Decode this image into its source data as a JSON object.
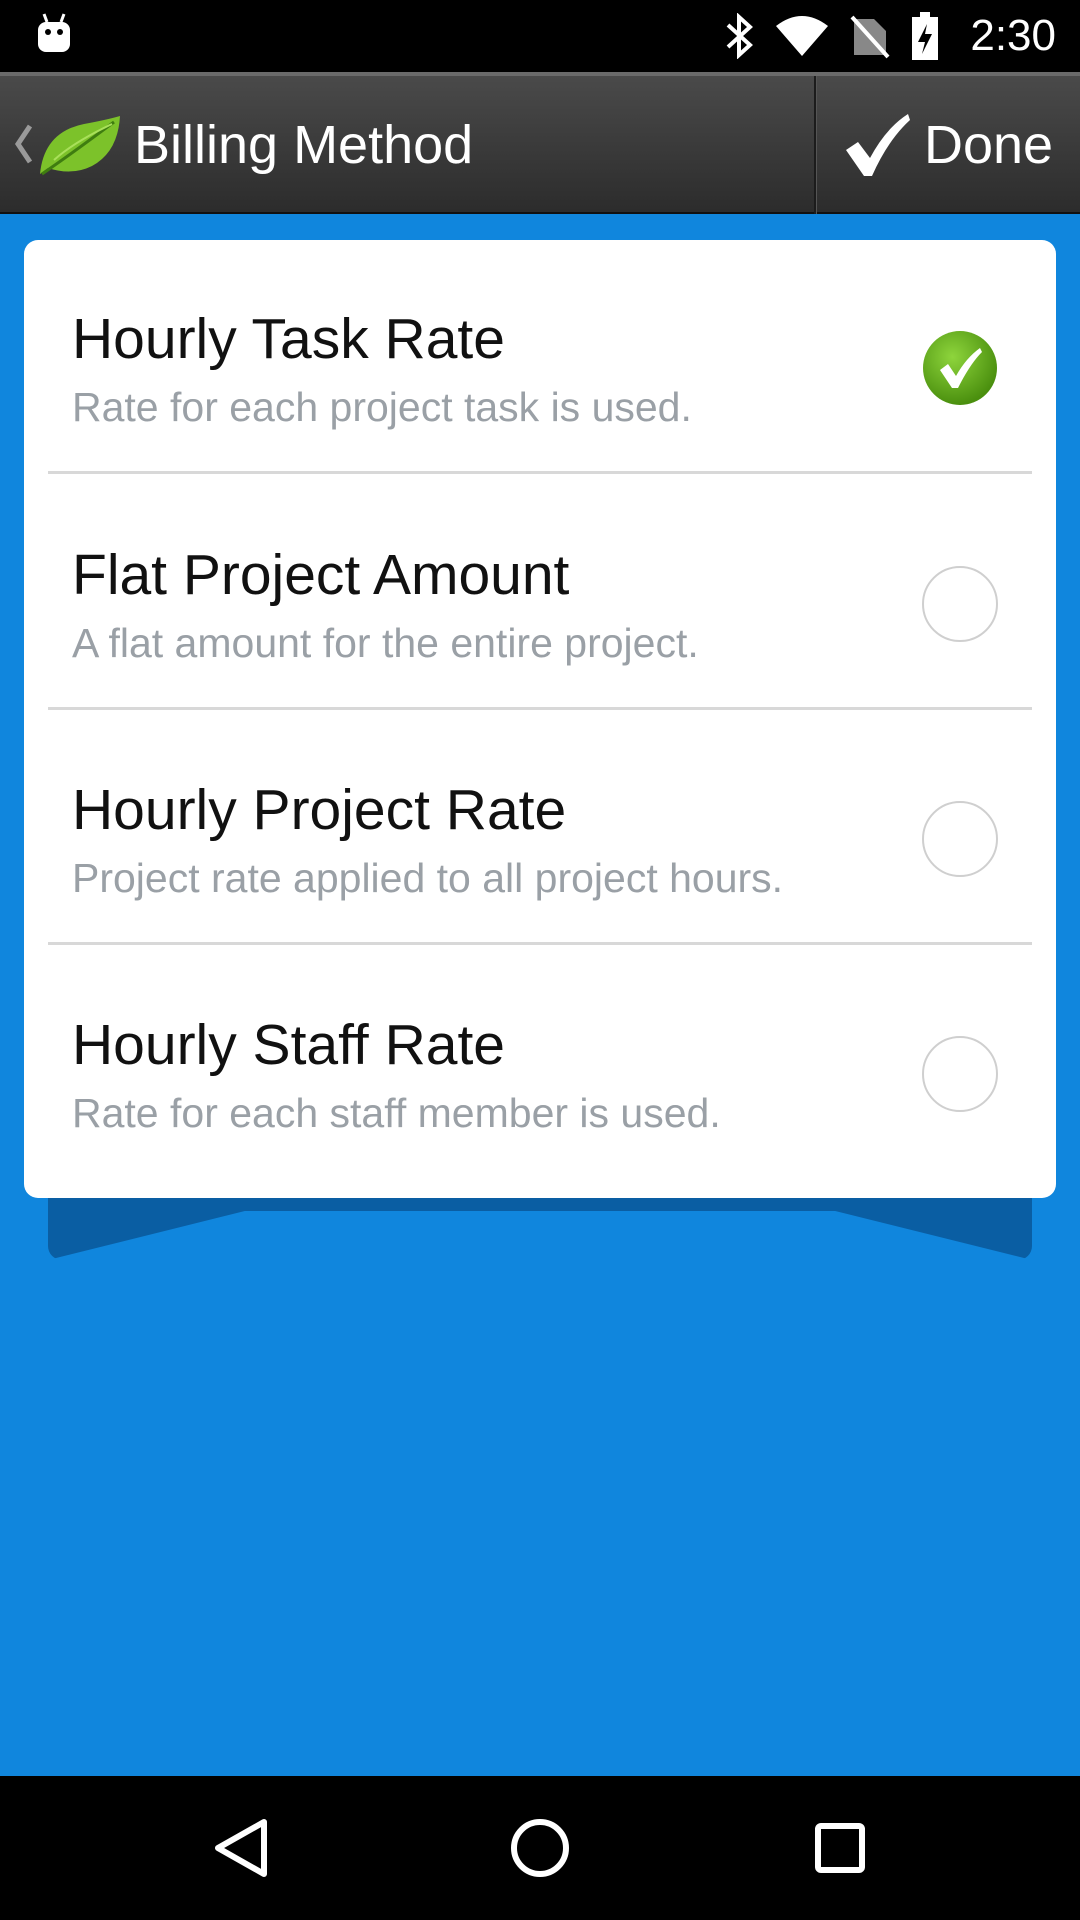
{
  "status_bar": {
    "time": "2:30",
    "icons": [
      "android-debug-icon",
      "bluetooth-icon",
      "wifi-icon",
      "no-sim-icon",
      "battery-charging-icon"
    ]
  },
  "action_bar": {
    "title": "Billing Method",
    "done_label": "Done"
  },
  "options": [
    {
      "title": "Hourly Task Rate",
      "description": "Rate for each project task is used.",
      "selected": true
    },
    {
      "title": "Flat Project Amount",
      "description": "A flat amount for the entire project.",
      "selected": false
    },
    {
      "title": "Hourly Project Rate",
      "description": "Project rate applied to all project hours.",
      "selected": false
    },
    {
      "title": "Hourly Staff Rate",
      "description": "Rate for each staff member is used.",
      "selected": false
    }
  ],
  "colors": {
    "content_background": "#1086dd",
    "selected_check": "#5ea416"
  },
  "nav_bar": {
    "icons": [
      "back-icon",
      "home-icon",
      "recents-icon"
    ]
  }
}
